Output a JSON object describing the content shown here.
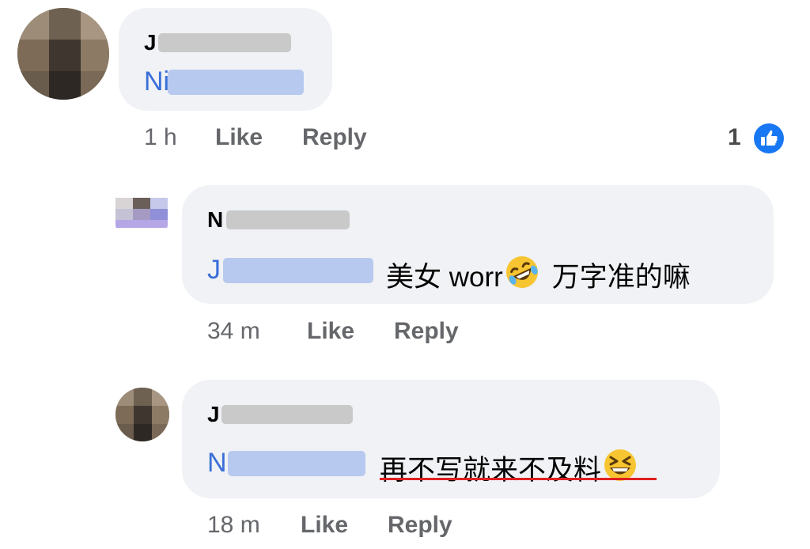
{
  "comments": [
    {
      "author_initial": "J",
      "mention_initial": "Ni",
      "message": "",
      "time": "1 h",
      "like_label": "Like",
      "reply_label": "Reply",
      "reaction_count": "1",
      "reaction_icon": "like-thumbs-up-icon"
    },
    {
      "author_initial": "N",
      "mention_initial": "J",
      "message": "美女 worr",
      "emoji": "rolling-on-floor-laughing-icon",
      "message_tail": "万字准的嘛",
      "time": "34 m",
      "like_label": "Like",
      "reply_label": "Reply"
    },
    {
      "author_initial": "J",
      "mention_initial": "N",
      "message": "再不写就来不及料",
      "emoji": "grinning-squinting-face-icon",
      "time": "18 m",
      "like_label": "Like",
      "reply_label": "Reply"
    }
  ],
  "colors": {
    "bubble": "#f0f2f5",
    "mention": "#3b6fd8",
    "meta": "#65676b",
    "like_badge": "#1877f2",
    "spellcheck_underline": "#e02020"
  }
}
